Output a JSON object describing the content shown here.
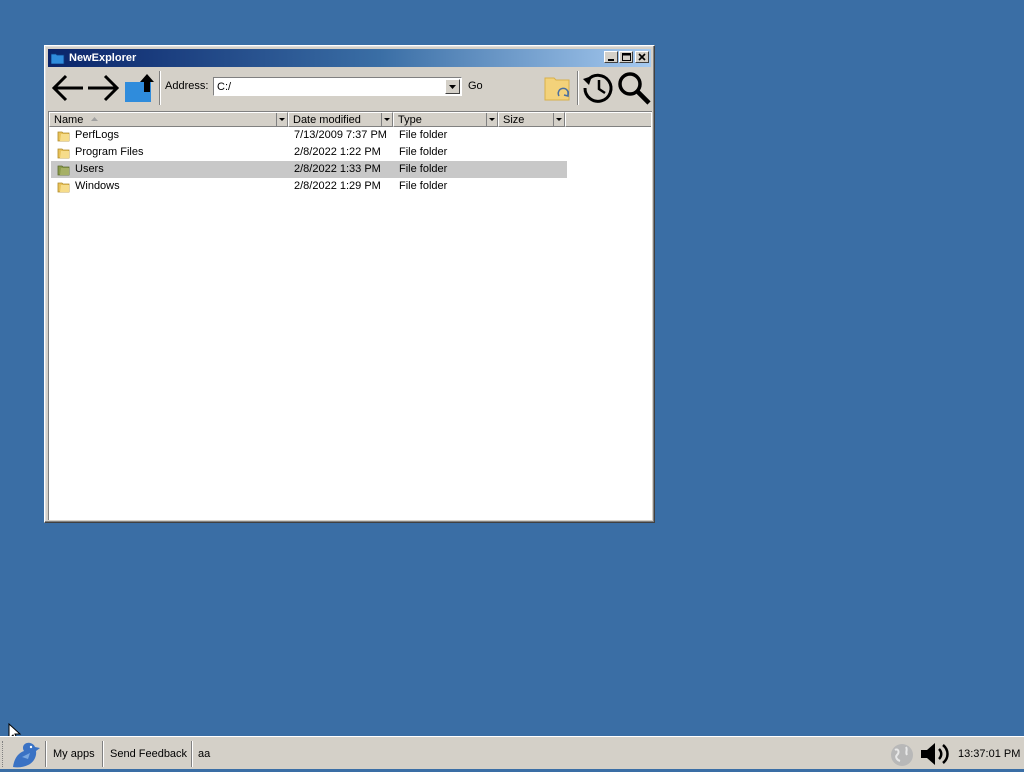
{
  "window": {
    "title": "NewExplorer",
    "controls": [
      "minimize",
      "maximize",
      "close"
    ]
  },
  "toolbar": {
    "back_icon": "arrow-left-icon",
    "forward_icon": "arrow-right-icon",
    "up_icon": "folder-up-icon",
    "address_label": "Address:",
    "address_value": "C:/",
    "go_label": "Go",
    "refresh_icon": "folder-refresh-icon",
    "history_icon": "history-icon",
    "search_icon": "search-icon"
  },
  "list": {
    "columns": [
      "Name",
      "Date modified",
      "Type",
      "Size"
    ],
    "sort_column": "Name",
    "rows": [
      {
        "name": "PerfLogs",
        "date": "7/13/2009 7:37 PM",
        "type": "File folder",
        "size": "",
        "selected": false
      },
      {
        "name": "Program Files",
        "date": "2/8/2022 1:22 PM",
        "type": "File folder",
        "size": "",
        "selected": false
      },
      {
        "name": "Users",
        "date": "2/8/2022 1:33 PM",
        "type": "File folder",
        "size": "",
        "selected": true
      },
      {
        "name": "Windows",
        "date": "2/8/2022 1:29 PM",
        "type": "File folder",
        "size": "",
        "selected": false
      }
    ]
  },
  "taskbar": {
    "start_icon": "start-logo-icon",
    "my_apps": "My apps",
    "send_feedback": "Send Feedback",
    "task": "aa",
    "tray_icons": [
      "network-icon",
      "volume-icon"
    ],
    "clock": "13:37:01 PM"
  },
  "colors": {
    "desktop": "#3a6ea5",
    "titlebar_start": "#0a246a",
    "titlebar_end": "#a6caf0",
    "chrome": "#d4d0c8",
    "selection": "#c8c8c8"
  }
}
